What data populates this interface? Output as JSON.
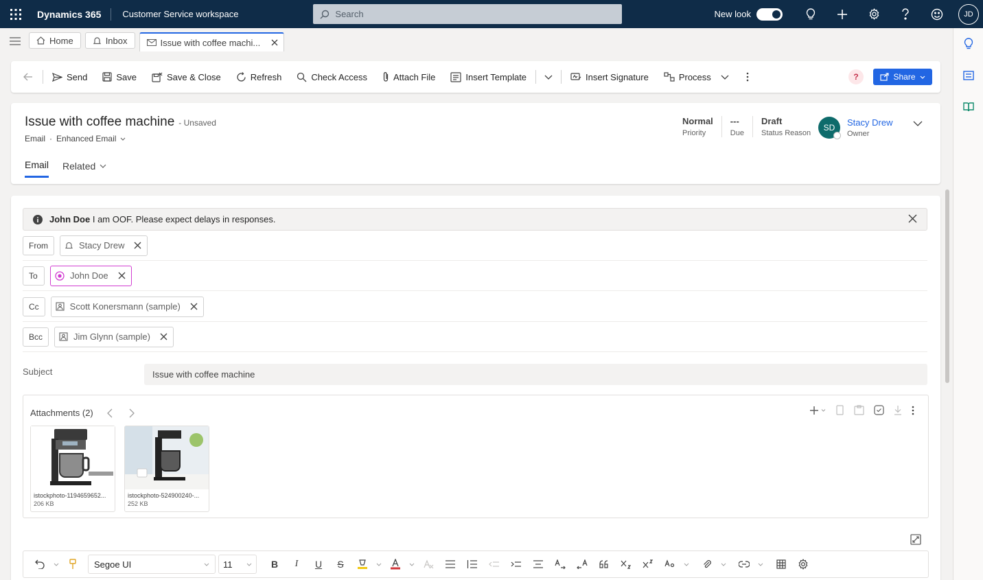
{
  "topbar": {
    "brand": "Dynamics 365",
    "app_name": "Customer Service workspace",
    "search_placeholder": "Search",
    "new_look_label": "New look",
    "user_initials": "JD"
  },
  "session_tabs": [
    {
      "label": "Home"
    },
    {
      "label": "Inbox"
    },
    {
      "label": "Issue with coffee machi..."
    }
  ],
  "commands": {
    "send": "Send",
    "save": "Save",
    "save_close": "Save & Close",
    "refresh": "Refresh",
    "check_access": "Check Access",
    "attach_file": "Attach File",
    "insert_template": "Insert Template",
    "insert_signature": "Insert Signature",
    "process": "Process",
    "share": "Share",
    "help": "?"
  },
  "record": {
    "title": "Issue with coffee machine",
    "unsaved": "- Unsaved",
    "entity": "Email",
    "form": "Enhanced Email",
    "tabs": [
      "Email",
      "Related"
    ],
    "fields": [
      {
        "value": "Normal",
        "label": "Priority"
      },
      {
        "value": "---",
        "label": "Due"
      },
      {
        "value": "Draft",
        "label": "Status Reason"
      }
    ],
    "owner": {
      "initials": "SD",
      "name": "Stacy Drew",
      "label": "Owner"
    }
  },
  "banner": {
    "bold": "John Doe",
    "text": " I am OOF. Please expect delays in responses."
  },
  "recipients": {
    "from": {
      "label": "From",
      "value": "Stacy Drew"
    },
    "to": {
      "label": "To",
      "value": "John Doe"
    },
    "cc": {
      "label": "Cc",
      "value": "Scott Konersmann (sample)"
    },
    "bcc": {
      "label": "Bcc",
      "value": "Jim Glynn (sample)"
    }
  },
  "subject": {
    "label": "Subject",
    "value": "Issue with coffee machine"
  },
  "attachments": {
    "title": "Attachments (2)",
    "items": [
      {
        "name": "istockphoto-1194659652...",
        "size": "206 KB"
      },
      {
        "name": "istockphoto-524900240-...",
        "size": "252 KB"
      }
    ]
  },
  "editor": {
    "font": "Segoe UI",
    "size": "11",
    "bold": "B",
    "italic": "I",
    "underline": "U",
    "strike": "S"
  },
  "colors": {
    "nav": "#0f2c48",
    "accent": "#2266e3",
    "owner_avatar": "#0e6b6b",
    "to_chip_border": "#d13bd1"
  }
}
